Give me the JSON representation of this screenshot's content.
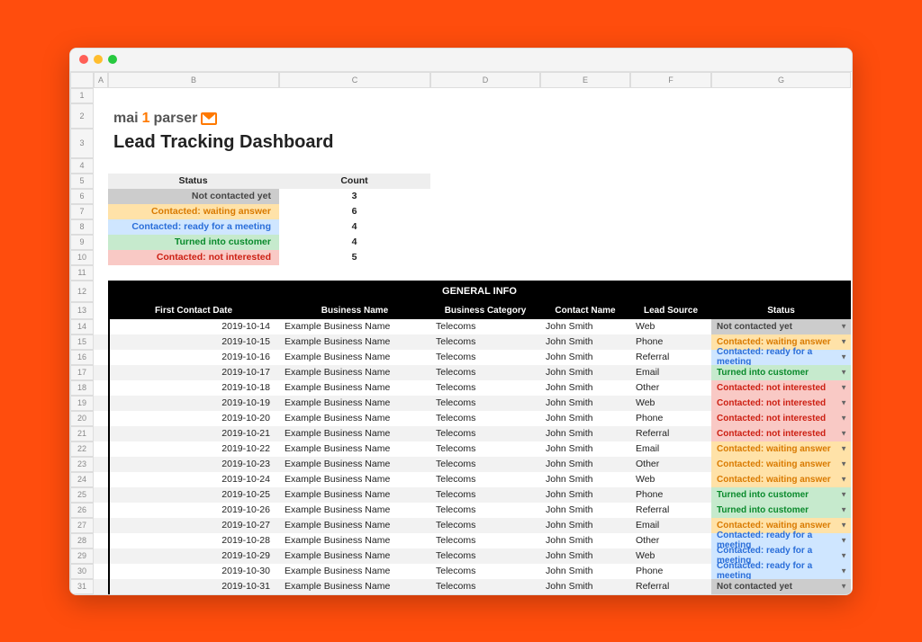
{
  "columns": [
    "A",
    "B",
    "C",
    "D",
    "E",
    "F",
    "G"
  ],
  "row_numbers": [
    1,
    2,
    3,
    4,
    5,
    6,
    7,
    8,
    9,
    10,
    11,
    12,
    13,
    14,
    15,
    16,
    17,
    18,
    19,
    20,
    21,
    22,
    23,
    24,
    25,
    26,
    27,
    28,
    29,
    30,
    31
  ],
  "logo_text": {
    "mai": "mai",
    "one": "1",
    "parser": "parser"
  },
  "title": "Lead Tracking Dashboard",
  "summary": {
    "header_status": "Status",
    "header_count": "Count",
    "rows": [
      {
        "label": "Not contacted yet",
        "count": "3",
        "class": "s-not"
      },
      {
        "label": "Contacted: waiting answer",
        "count": "6",
        "class": "s-wait"
      },
      {
        "label": "Contacted: ready for a meeting",
        "count": "4",
        "class": "s-ready"
      },
      {
        "label": "Turned into customer",
        "count": "4",
        "class": "s-cust"
      },
      {
        "label": "Contacted: not interested",
        "count": "5",
        "class": "s-noti"
      }
    ]
  },
  "section_title": "GENERAL INFO",
  "table_headers": [
    "First Contact Date",
    "Business Name",
    "Business Category",
    "Contact Name",
    "Lead Source",
    "Status"
  ],
  "rows": [
    {
      "date": "2019-10-14",
      "biz": "Example Business Name",
      "cat": "Telecoms",
      "contact": "John Smith",
      "source": "Web",
      "status": "Not contacted yet",
      "sclass": "s-not"
    },
    {
      "date": "2019-10-15",
      "biz": "Example Business Name",
      "cat": "Telecoms",
      "contact": "John Smith",
      "source": "Phone",
      "status": "Contacted: waiting answer",
      "sclass": "s-wait"
    },
    {
      "date": "2019-10-16",
      "biz": "Example Business Name",
      "cat": "Telecoms",
      "contact": "John Smith",
      "source": "Referral",
      "status": "Contacted: ready for a meeting",
      "sclass": "s-ready"
    },
    {
      "date": "2019-10-17",
      "biz": "Example Business Name",
      "cat": "Telecoms",
      "contact": "John Smith",
      "source": "Email",
      "status": "Turned into customer",
      "sclass": "s-cust"
    },
    {
      "date": "2019-10-18",
      "biz": "Example Business Name",
      "cat": "Telecoms",
      "contact": "John Smith",
      "source": "Other",
      "status": "Contacted: not interested",
      "sclass": "s-noti"
    },
    {
      "date": "2019-10-19",
      "biz": "Example Business Name",
      "cat": "Telecoms",
      "contact": "John Smith",
      "source": "Web",
      "status": "Contacted: not interested",
      "sclass": "s-noti"
    },
    {
      "date": "2019-10-20",
      "biz": "Example Business Name",
      "cat": "Telecoms",
      "contact": "John Smith",
      "source": "Phone",
      "status": "Contacted: not interested",
      "sclass": "s-noti"
    },
    {
      "date": "2019-10-21",
      "biz": "Example Business Name",
      "cat": "Telecoms",
      "contact": "John Smith",
      "source": "Referral",
      "status": "Contacted: not interested",
      "sclass": "s-noti"
    },
    {
      "date": "2019-10-22",
      "biz": "Example Business Name",
      "cat": "Telecoms",
      "contact": "John Smith",
      "source": "Email",
      "status": "Contacted: waiting answer",
      "sclass": "s-wait"
    },
    {
      "date": "2019-10-23",
      "biz": "Example Business Name",
      "cat": "Telecoms",
      "contact": "John Smith",
      "source": "Other",
      "status": "Contacted: waiting answer",
      "sclass": "s-wait"
    },
    {
      "date": "2019-10-24",
      "biz": "Example Business Name",
      "cat": "Telecoms",
      "contact": "John Smith",
      "source": "Web",
      "status": "Contacted: waiting answer",
      "sclass": "s-wait"
    },
    {
      "date": "2019-10-25",
      "biz": "Example Business Name",
      "cat": "Telecoms",
      "contact": "John Smith",
      "source": "Phone",
      "status": "Turned into customer",
      "sclass": "s-cust"
    },
    {
      "date": "2019-10-26",
      "biz": "Example Business Name",
      "cat": "Telecoms",
      "contact": "John Smith",
      "source": "Referral",
      "status": "Turned into customer",
      "sclass": "s-cust"
    },
    {
      "date": "2019-10-27",
      "biz": "Example Business Name",
      "cat": "Telecoms",
      "contact": "John Smith",
      "source": "Email",
      "status": "Contacted: waiting answer",
      "sclass": "s-wait"
    },
    {
      "date": "2019-10-28",
      "biz": "Example Business Name",
      "cat": "Telecoms",
      "contact": "John Smith",
      "source": "Other",
      "status": "Contacted: ready for a meeting",
      "sclass": "s-ready"
    },
    {
      "date": "2019-10-29",
      "biz": "Example Business Name",
      "cat": "Telecoms",
      "contact": "John Smith",
      "source": "Web",
      "status": "Contacted: ready for a meeting",
      "sclass": "s-ready"
    },
    {
      "date": "2019-10-30",
      "biz": "Example Business Name",
      "cat": "Telecoms",
      "contact": "John Smith",
      "source": "Phone",
      "status": "Contacted: ready for a meeting",
      "sclass": "s-ready"
    },
    {
      "date": "2019-10-31",
      "biz": "Example Business Name",
      "cat": "Telecoms",
      "contact": "John Smith",
      "source": "Referral",
      "status": "Not contacted yet",
      "sclass": "s-not"
    }
  ]
}
